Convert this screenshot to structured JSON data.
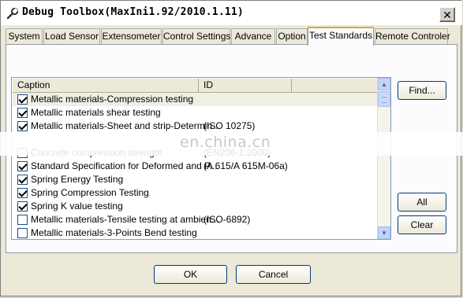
{
  "window": {
    "title": "Debug Toolbox(MaxIni1.92/2010.1.11)",
    "close_glyph": "✕"
  },
  "tabs": [
    {
      "label": "System",
      "active": false
    },
    {
      "label": "Load Sensor",
      "active": false
    },
    {
      "label": "Extensometer",
      "active": false
    },
    {
      "label": "Control Settings",
      "active": false
    },
    {
      "label": "Advance",
      "active": false
    },
    {
      "label": "Option",
      "active": false
    },
    {
      "label": "Test Standards",
      "active": true
    },
    {
      "label": "Remote Controler",
      "active": false
    }
  ],
  "list": {
    "columns": [
      "Caption",
      "ID"
    ],
    "rows": [
      {
        "caption": "Metallic materials-Compression testing",
        "id": "",
        "checked": true
      },
      {
        "caption": "Metallic materials shear testing",
        "id": "",
        "checked": true
      },
      {
        "caption": "Metallic materials-Sheet and strip-Determin...",
        "id": "(ISO 10275)",
        "checked": true
      },
      {
        "caption": "Concrete compression strength",
        "id": "(EN206-1:2000)",
        "checked": false
      },
      {
        "caption": "Standard Specification for Deformed and P...",
        "id": "(A 615/A 615M-06a)",
        "checked": true
      },
      {
        "caption": "Spring Energy Testing",
        "id": "",
        "checked": true
      },
      {
        "caption": "Spring Compression Testing",
        "id": "",
        "checked": true
      },
      {
        "caption": "Spring K value testing",
        "id": "",
        "checked": true
      },
      {
        "caption": "Metallic materials-Tensile testing at ambien...",
        "id": "(ISO-6892)",
        "checked": false
      },
      {
        "caption": "Metallic materials-3-Points Bend testing",
        "id": "",
        "checked": false
      }
    ]
  },
  "buttons": {
    "find": "Find...",
    "all": "All",
    "clear": "Clear",
    "ok": "OK",
    "cancel": "Cancel"
  },
  "watermark": "en.china.cn",
  "colors": {
    "tab_accent": "#e9a23a",
    "button_border": "#003c74",
    "checkbox_border": "#1c5180"
  }
}
